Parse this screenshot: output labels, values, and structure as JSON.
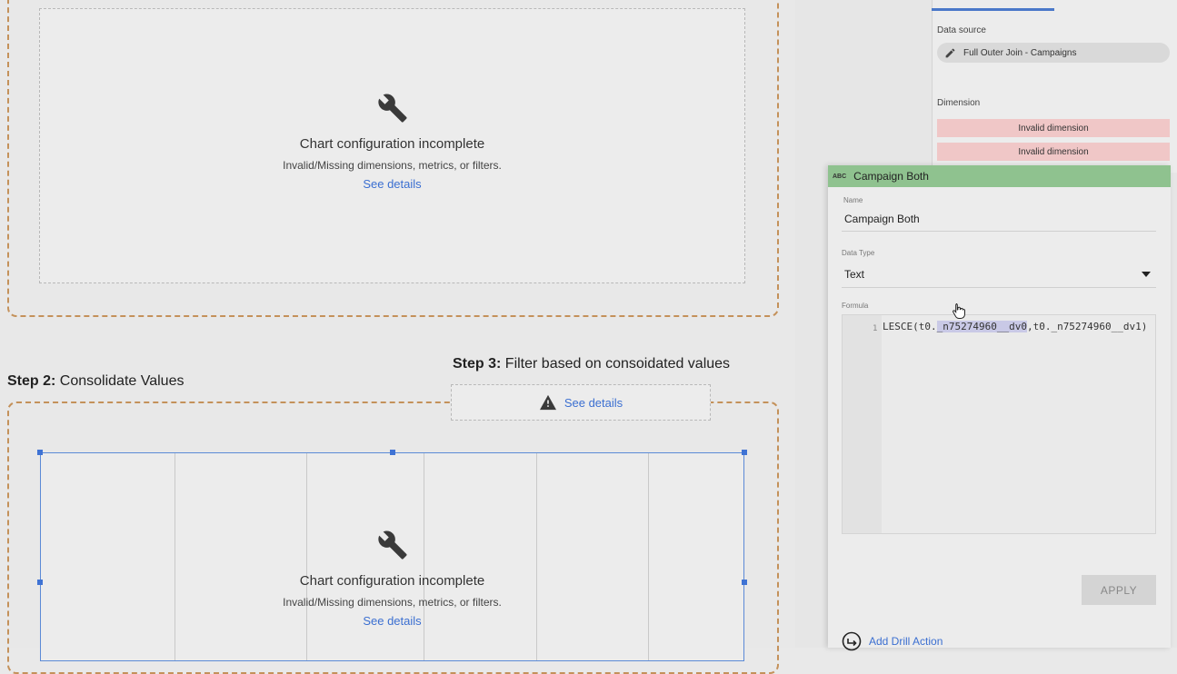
{
  "chart_messages": {
    "top": {
      "title": "Chart configuration incomplete",
      "subtitle": "Invalid/Missing dimensions, metrics, or filters.",
      "link": "See details"
    },
    "bottom": {
      "title": "Chart configuration incomplete",
      "subtitle": "Invalid/Missing dimensions, metrics, or filters.",
      "link": "See details"
    }
  },
  "steps": {
    "step2": {
      "bold": "Step 2:",
      "text": " Consolidate Values"
    },
    "step3": {
      "bold": "Step 3:",
      "text": " Filter based on consoidated values"
    }
  },
  "warning": {
    "link": "See details"
  },
  "setup_panel": {
    "data_source_label": "Data source",
    "data_source_value": "Full Outer Join - Campaigns",
    "dimension_label": "Dimension",
    "dimensions": [
      "Invalid dimension",
      "Invalid dimension"
    ]
  },
  "field_editor": {
    "type_badge": "ABC",
    "header_title": "Campaign Both",
    "name_label": "Name",
    "name_value": "Campaign Both",
    "data_type_label": "Data Type",
    "data_type_value": "Text",
    "formula_label": "Formula",
    "line_number": "1",
    "formula_prefix": "LESCE(t0.",
    "formula_highlight": "_n75274960__dv0",
    "formula_suffix": ",t0._n75274960__dv1)",
    "apply_label": "APPLY",
    "drill_label": "Add Drill Action"
  },
  "colors": {
    "accent_blue": "#3b6fd1",
    "section_border": "#c4915a",
    "editor_header": "#8fc28f",
    "invalid_chip": "#f0c7c7"
  }
}
